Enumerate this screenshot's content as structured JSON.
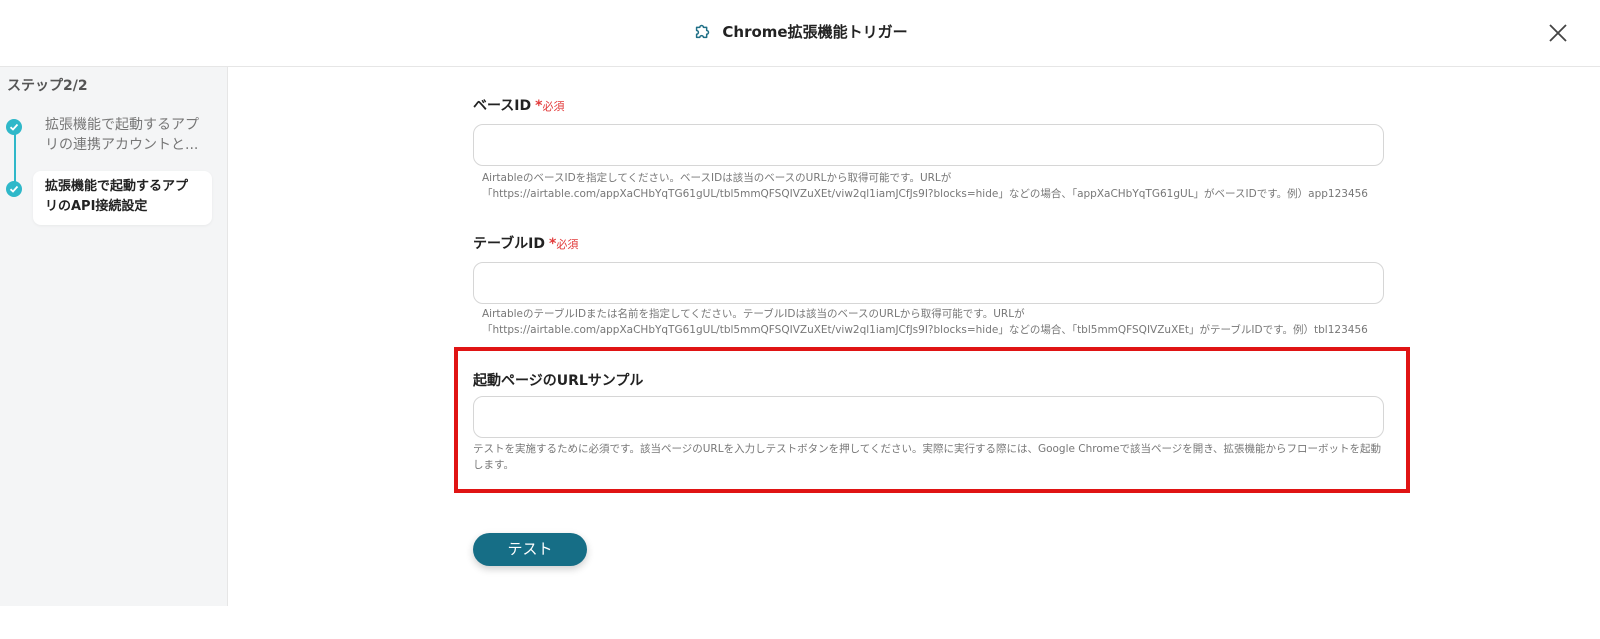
{
  "header": {
    "title": "Chrome拡張機能トリガー",
    "icon": "puzzle-icon",
    "close_icon": "close-icon"
  },
  "sidebar": {
    "step_count": "ステップ2/2",
    "steps": [
      {
        "label": "拡張機能で起動するアプリの連携アカウントと...",
        "status": "done"
      },
      {
        "label": "拡張機能で起動するアプリのAPI接続設定",
        "status": "current"
      }
    ]
  },
  "form": {
    "required_label": "必須",
    "fields": [
      {
        "label": "ベースID",
        "required": true,
        "value": "",
        "help": "AirtableのベースIDを指定してください。ベースIDは該当のベースのURLから取得可能です。URLが「https://airtable.com/appXaCHbYqTG61gUL/tbl5mmQFSQIVZuXEt/viw2ql1iamJCfJs9I?blocks=hide」などの場合、「appXaCHbYqTG61gUL」がベースIDです。例）app123456"
      },
      {
        "label": "テーブルID",
        "required": true,
        "value": "",
        "help_line1": "Airtableのテーブル​IDまたは名前を指定してください。テーブルIDは該当のベースのURLから取得可能です。URLが",
        "help_line2": "「https://airtable.com/appXaCHbYqTG61gUL/tbl5mmQFSQIVZuXEt/viw2ql1iamJCfJs9I?blocks=hide」などの場合、「tbl5mmQFSQIVZuXEt」がテーブルIDです。例）tbl123456"
      },
      {
        "label": "起動ページのURLサンプル",
        "required": false,
        "value": "",
        "help": "テストを実施するために必須です。該当ページのURLを入力しテストボタンを押してください。実際に実行する際には、Google Chromeで該当ページを開き、拡張機能からフローボットを起動します。"
      }
    ]
  },
  "actions": {
    "test_label": "テスト"
  },
  "colors": {
    "accent": "#2fb8c9",
    "button": "#166e86",
    "required": "#e23a3a",
    "highlight": "#e01414"
  }
}
